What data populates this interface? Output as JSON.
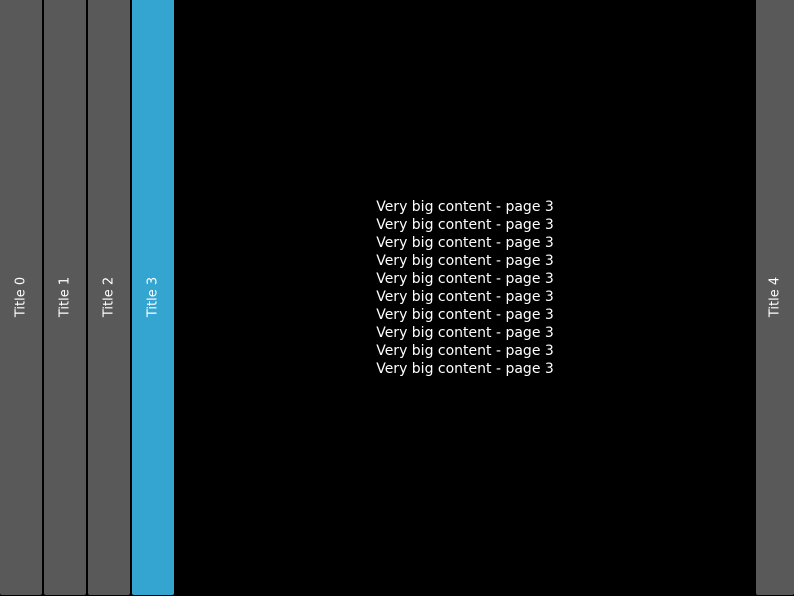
{
  "tabs": [
    {
      "label": "Title 0"
    },
    {
      "label": "Title 1"
    },
    {
      "label": "Title 2"
    },
    {
      "label": "Title 3",
      "active": true
    },
    {
      "label": "Title 4"
    }
  ],
  "content": {
    "lines": [
      "Very big content - page 3",
      "Very big content - page 3",
      "Very big content - page 3",
      "Very big content - page 3",
      "Very big content - page 3",
      "Very big content - page 3",
      "Very big content - page 3",
      "Very big content - page 3",
      "Very big content - page 3",
      "Very big content - page 3"
    ]
  },
  "colors": {
    "tab": "#595959",
    "active_tab": "#33a5d0",
    "background": "#000000"
  }
}
